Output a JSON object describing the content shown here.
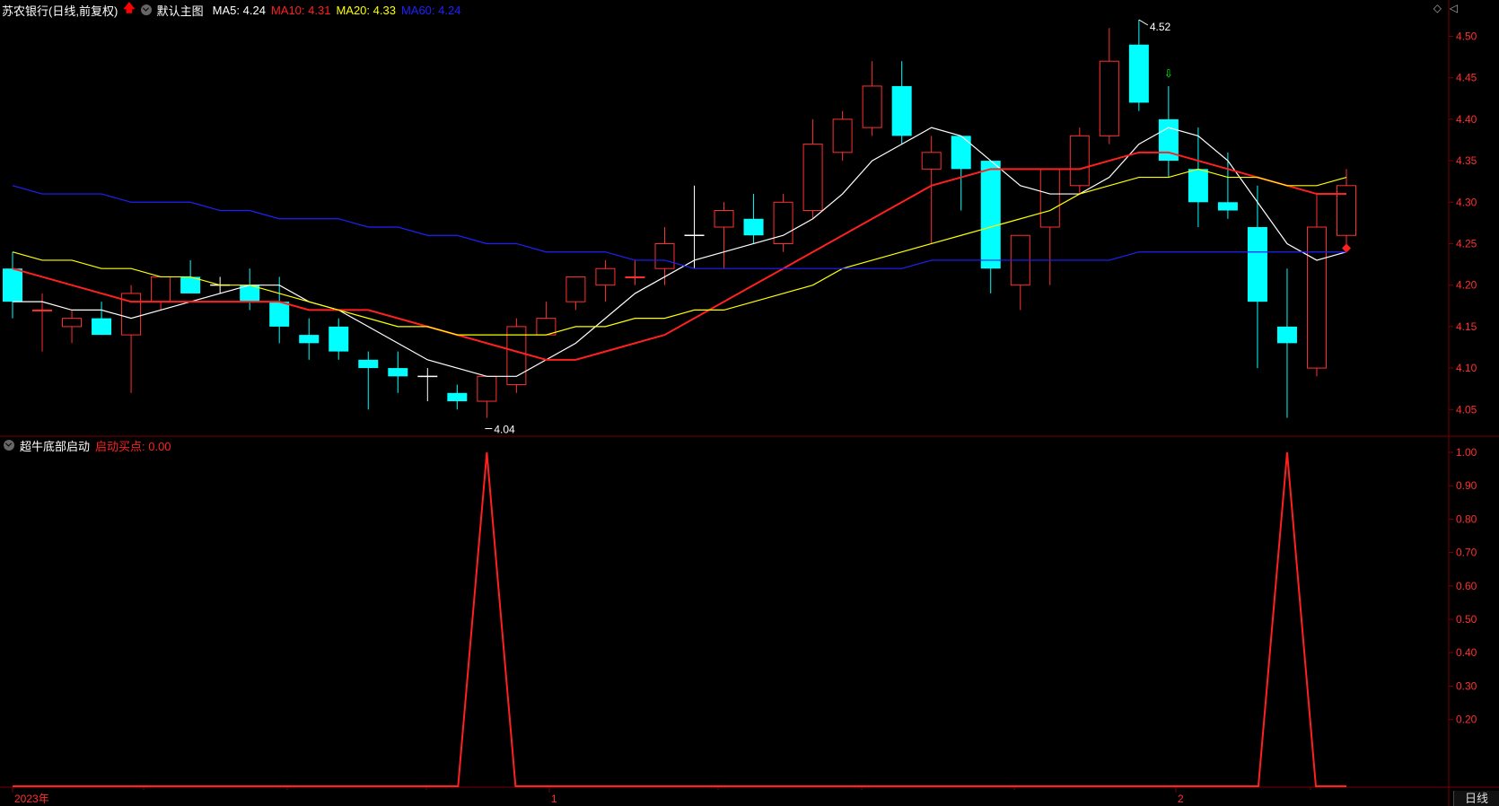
{
  "header": {
    "stock_title": "苏农银行(日线,前复权)",
    "arrow_color": "#ff0000",
    "template": "默认主图",
    "ma": [
      {
        "label": "MA5: 4.24",
        "color": "#ffffff"
      },
      {
        "label": "MA10: 4.31",
        "color": "#ff2020"
      },
      {
        "label": "MA20: 4.33",
        "color": "#ffff00"
      },
      {
        "label": "MA60: 4.24",
        "color": "#2020ff"
      }
    ]
  },
  "sub_header": {
    "indicator_name": "超牛底部启动",
    "value_label": "启动买点: 0.00",
    "value_color": "#ff2020"
  },
  "chart_data": [
    {
      "type": "candlestick",
      "title": "苏农银行(日线,前复权)",
      "ylim": [
        4.02,
        4.52
      ],
      "y_ticks": [
        "4.50",
        "4.45",
        "4.40",
        "4.35",
        "4.30",
        "4.25",
        "4.20",
        "4.15",
        "4.10",
        "4.05"
      ],
      "annotations": [
        {
          "text": "4.52",
          "kind": "high"
        },
        {
          "text": "4.04",
          "kind": "low"
        }
      ],
      "candles": [
        [
          4.22,
          4.24,
          4.16,
          4.18
        ],
        [
          4.17,
          4.19,
          4.12,
          4.17
        ],
        [
          4.15,
          4.17,
          4.13,
          4.16
        ],
        [
          4.16,
          4.18,
          4.14,
          4.14
        ],
        [
          4.14,
          4.2,
          4.07,
          4.19
        ],
        [
          4.18,
          4.21,
          4.17,
          4.21
        ],
        [
          4.21,
          4.23,
          4.19,
          4.19
        ],
        [
          4.2,
          4.21,
          4.19,
          4.2
        ],
        [
          4.2,
          4.22,
          4.17,
          4.18
        ],
        [
          4.18,
          4.21,
          4.13,
          4.15
        ],
        [
          4.14,
          4.16,
          4.11,
          4.13
        ],
        [
          4.15,
          4.16,
          4.11,
          4.12
        ],
        [
          4.11,
          4.12,
          4.05,
          4.1
        ],
        [
          4.1,
          4.12,
          4.07,
          4.09
        ],
        [
          4.09,
          4.1,
          4.06,
          4.08
        ],
        [
          4.07,
          4.08,
          4.05,
          4.06
        ],
        [
          4.06,
          4.09,
          4.04,
          4.09
        ],
        [
          4.08,
          4.16,
          4.07,
          4.15
        ],
        [
          4.14,
          4.18,
          4.14,
          4.16
        ],
        [
          4.18,
          4.21,
          4.17,
          4.21
        ],
        [
          4.2,
          4.23,
          4.18,
          4.22
        ],
        [
          4.21,
          4.23,
          4.2,
          4.21
        ],
        [
          4.22,
          4.27,
          4.2,
          4.25
        ],
        [
          4.26,
          4.32,
          4.22,
          4.26
        ],
        [
          4.27,
          4.3,
          4.22,
          4.29
        ],
        [
          4.28,
          4.31,
          4.25,
          4.26
        ],
        [
          4.25,
          4.31,
          4.24,
          4.3
        ],
        [
          4.29,
          4.4,
          4.28,
          4.37
        ],
        [
          4.36,
          4.41,
          4.35,
          4.4
        ],
        [
          4.39,
          4.47,
          4.38,
          4.44
        ],
        [
          4.44,
          4.47,
          4.37,
          4.38
        ],
        [
          4.36,
          4.38,
          4.25,
          4.34
        ],
        [
          4.38,
          4.38,
          4.29,
          4.34
        ],
        [
          4.35,
          4.35,
          4.19,
          4.22
        ],
        [
          4.2,
          4.25,
          4.17,
          4.26
        ],
        [
          4.27,
          4.34,
          4.2,
          4.34
        ],
        [
          4.32,
          4.39,
          4.31,
          4.38
        ],
        [
          4.38,
          4.51,
          4.37,
          4.47
        ],
        [
          4.49,
          4.52,
          4.41,
          4.42
        ],
        [
          4.4,
          4.44,
          4.33,
          4.35
        ],
        [
          4.34,
          4.39,
          4.27,
          4.3
        ],
        [
          4.3,
          4.36,
          4.28,
          4.29
        ],
        [
          4.27,
          4.32,
          4.1,
          4.18
        ],
        [
          4.15,
          4.22,
          4.04,
          4.13
        ],
        [
          4.1,
          4.31,
          4.09,
          4.27
        ],
        [
          4.26,
          4.34,
          4.24,
          4.32
        ]
      ],
      "candle_directions": [
        "down",
        "up",
        "up",
        "down",
        "up",
        "up",
        "down",
        "doji",
        "down",
        "down",
        "down",
        "down",
        "down",
        "down",
        "doji",
        "down",
        "up",
        "up",
        "up",
        "up",
        "up",
        "up",
        "up",
        "doji",
        "up",
        "down",
        "up",
        "up",
        "up",
        "up",
        "down",
        "up",
        "down",
        "down",
        "up",
        "up",
        "up",
        "up",
        "down",
        "down",
        "down",
        "down",
        "down",
        "down",
        "up",
        "up"
      ],
      "series": [
        {
          "name": "MA5",
          "color": "#ffffff",
          "values": [
            4.18,
            4.18,
            4.17,
            4.17,
            4.16,
            4.17,
            4.18,
            4.19,
            4.2,
            4.2,
            4.18,
            4.17,
            4.15,
            4.13,
            4.11,
            4.1,
            4.09,
            4.09,
            4.11,
            4.13,
            4.16,
            4.19,
            4.21,
            4.23,
            4.24,
            4.25,
            4.26,
            4.28,
            4.31,
            4.35,
            4.37,
            4.39,
            4.38,
            4.35,
            4.32,
            4.31,
            4.31,
            4.33,
            4.37,
            4.39,
            4.38,
            4.35,
            4.3,
            4.25,
            4.23,
            4.24
          ]
        },
        {
          "name": "MA10",
          "color": "#ff2020",
          "values": [
            4.22,
            4.21,
            4.2,
            4.19,
            4.18,
            4.18,
            4.18,
            4.18,
            4.18,
            4.18,
            4.17,
            4.17,
            4.17,
            4.16,
            4.15,
            4.14,
            4.13,
            4.12,
            4.11,
            4.11,
            4.12,
            4.13,
            4.14,
            4.16,
            4.18,
            4.2,
            4.22,
            4.24,
            4.26,
            4.28,
            4.3,
            4.32,
            4.33,
            4.34,
            4.34,
            4.34,
            4.34,
            4.35,
            4.36,
            4.36,
            4.35,
            4.34,
            4.33,
            4.32,
            4.31,
            4.31
          ]
        },
        {
          "name": "MA20",
          "color": "#ffff00",
          "values": [
            4.24,
            4.23,
            4.23,
            4.22,
            4.22,
            4.21,
            4.21,
            4.2,
            4.2,
            4.19,
            4.18,
            4.17,
            4.16,
            4.15,
            4.15,
            4.14,
            4.14,
            4.14,
            4.14,
            4.15,
            4.15,
            4.16,
            4.16,
            4.17,
            4.17,
            4.18,
            4.19,
            4.2,
            4.22,
            4.23,
            4.24,
            4.25,
            4.26,
            4.27,
            4.28,
            4.29,
            4.31,
            4.32,
            4.33,
            4.33,
            4.34,
            4.33,
            4.33,
            4.32,
            4.32,
            4.33
          ]
        },
        {
          "name": "MA60",
          "color": "#2020ff",
          "values": [
            4.32,
            4.31,
            4.31,
            4.31,
            4.3,
            4.3,
            4.3,
            4.29,
            4.29,
            4.28,
            4.28,
            4.28,
            4.27,
            4.27,
            4.26,
            4.26,
            4.25,
            4.25,
            4.24,
            4.24,
            4.24,
            4.23,
            4.23,
            4.22,
            4.22,
            4.22,
            4.22,
            4.22,
            4.22,
            4.22,
            4.22,
            4.23,
            4.23,
            4.23,
            4.23,
            4.23,
            4.23,
            4.23,
            4.24,
            4.24,
            4.24,
            4.24,
            4.24,
            4.24,
            4.24,
            4.24
          ]
        }
      ]
    },
    {
      "type": "line",
      "title": "超牛底部启动",
      "ylim": [
        0,
        1.0
      ],
      "y_ticks": [
        "1.00",
        "0.90",
        "0.80",
        "0.70",
        "0.60",
        "0.50",
        "0.40",
        "0.30",
        "0.20"
      ],
      "x_labels": [
        "2023年",
        "1",
        "2"
      ],
      "series": [
        {
          "name": "启动买点",
          "color": "#ff2020",
          "values": [
            0,
            0,
            0,
            0,
            0,
            0,
            0,
            0,
            0,
            0,
            0,
            0,
            0,
            0,
            0,
            0,
            1,
            0,
            0,
            0,
            0,
            0,
            0,
            0,
            0,
            0,
            0,
            0,
            0,
            0,
            0,
            0,
            0,
            0,
            0,
            0,
            0,
            0,
            0,
            0,
            0,
            0,
            0,
            1,
            0,
            0
          ]
        }
      ]
    }
  ],
  "bottom_tab": "日线",
  "colors": {
    "up": "#ff3030",
    "down": "#00ffff",
    "grid": "#7a0000",
    "axis_text": "#ff3030"
  }
}
